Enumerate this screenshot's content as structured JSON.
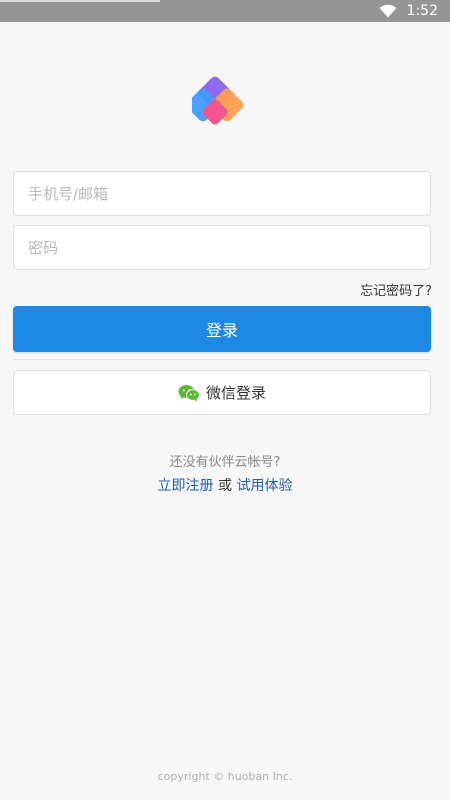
{
  "status_bar": {
    "time": "1:52",
    "wifi_icon": "wifi-icon"
  },
  "logo": {
    "icon": "app-logo-icon"
  },
  "login_form": {
    "account_placeholder": "手机号/邮箱",
    "password_placeholder": "密码",
    "forgot_password": "忘记密码了?",
    "login_label": "登录",
    "wechat_icon": "wechat-icon",
    "wechat_login_label": "微信登录"
  },
  "signup": {
    "prompt": "还没有伙伴云帐号?",
    "register_label": "立即注册",
    "or_label": "或",
    "trial_label": "试用体验"
  },
  "footer": {
    "copyright": "copyright © huoban Inc."
  },
  "colors": {
    "primary": "#1e88e5",
    "link": "#1d5fa8",
    "wechat_green": "#5cb832",
    "background": "#f7f7f7"
  }
}
